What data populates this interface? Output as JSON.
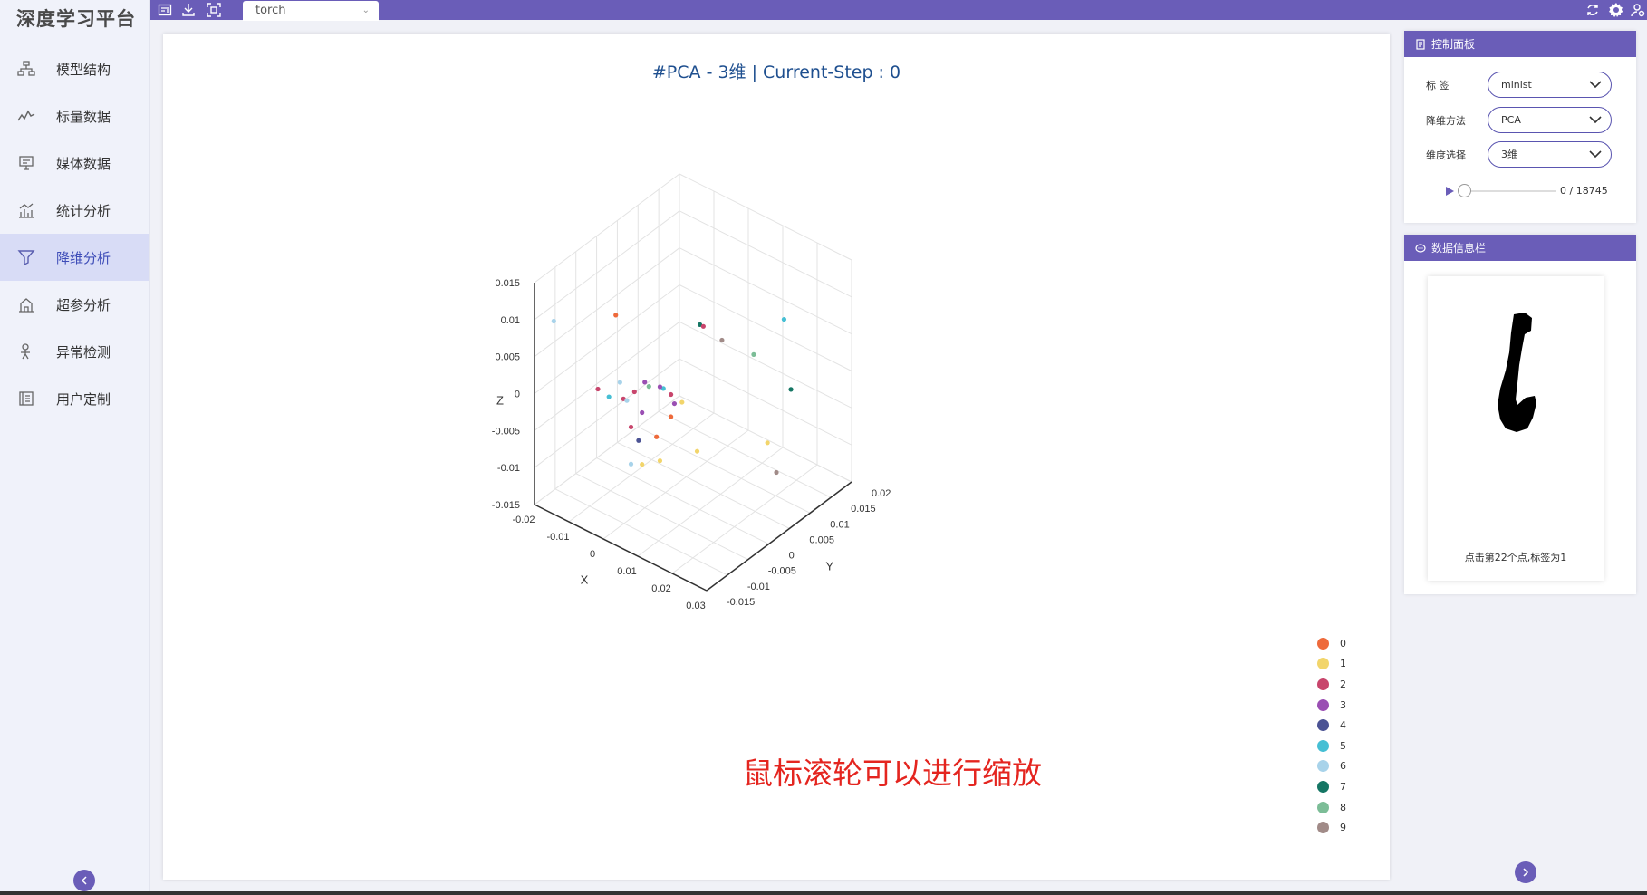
{
  "app": {
    "title": "深度学习平台"
  },
  "sidebar": {
    "items": [
      {
        "label": "模型结构",
        "icon": "model-structure-icon"
      },
      {
        "label": "标量数据",
        "icon": "scalar-line-icon"
      },
      {
        "label": "媒体数据",
        "icon": "media-monitor-icon"
      },
      {
        "label": "统计分析",
        "icon": "statistics-icon"
      },
      {
        "label": "降维分析",
        "icon": "funnel-icon",
        "active": true
      },
      {
        "label": "超参分析",
        "icon": "hyperparam-icon"
      },
      {
        "label": "异常检测",
        "icon": "anomaly-icon"
      },
      {
        "label": "用户定制",
        "icon": "custom-icon"
      }
    ]
  },
  "topbar": {
    "tab_label": "torch"
  },
  "chart": {
    "title": "#PCA - 3维 | Current-Step : 0",
    "zoom_hint": "鼠标滚轮可以进行缩放"
  },
  "chart_data": {
    "type": "scatter",
    "dimensions": 3,
    "xlabel": "X",
    "ylabel": "Y",
    "zlabel": "Z",
    "x_ticks": [
      "-0.02",
      "-0.01",
      "0",
      "0.01",
      "0.02",
      "0.03"
    ],
    "y_ticks": [
      "-0.015",
      "-0.01",
      "-0.005",
      "0",
      "0.005",
      "0.01",
      "0.015",
      "0.02"
    ],
    "z_ticks": [
      "-0.015",
      "-0.01",
      "-0.005",
      "0",
      "0.005",
      "0.01",
      "0.015"
    ],
    "legend": [
      {
        "name": "0",
        "color": "#ee6a3b"
      },
      {
        "name": "1",
        "color": "#f2d56b"
      },
      {
        "name": "2",
        "color": "#c8456c"
      },
      {
        "name": "3",
        "color": "#9a4fb3"
      },
      {
        "name": "4",
        "color": "#4b5394"
      },
      {
        "name": "5",
        "color": "#46bfd4"
      },
      {
        "name": "6",
        "color": "#a8d3ea"
      },
      {
        "name": "7",
        "color": "#157664"
      },
      {
        "name": "8",
        "color": "#7cbd97"
      },
      {
        "name": "9",
        "color": "#a18b88"
      }
    ],
    "points_screen_note": "projected scatter points",
    "points": [
      {
        "label": "0",
        "x": 0.0,
        "y": -0.012,
        "z": 0.014
      },
      {
        "label": "6",
        "x": -0.018,
        "y": -0.012,
        "z": 0.009
      },
      {
        "label": "7",
        "x": 0.01,
        "y": 0.0,
        "z": 0.01
      },
      {
        "label": "2",
        "x": 0.011,
        "y": 0.0,
        "z": 0.01
      },
      {
        "label": "9",
        "x": 0.014,
        "y": 0.002,
        "z": 0.008
      },
      {
        "label": "5",
        "x": 0.02,
        "y": 0.012,
        "z": 0.008
      },
      {
        "label": "8",
        "x": 0.016,
        "y": 0.008,
        "z": 0.004
      },
      {
        "label": "7",
        "x": 0.022,
        "y": 0.012,
        "z": -0.001
      },
      {
        "label": "3",
        "x": 0.0,
        "y": -0.005,
        "z": 0.002
      },
      {
        "label": "6",
        "x": -0.006,
        "y": -0.006,
        "z": 0.001
      },
      {
        "label": "2",
        "x": -0.01,
        "y": -0.008,
        "z": 0.0
      },
      {
        "label": "5",
        "x": -0.008,
        "y": -0.007,
        "z": -0.001
      },
      {
        "label": "2",
        "x": -0.005,
        "y": -0.006,
        "z": -0.001
      },
      {
        "label": "6",
        "x": -0.004,
        "y": -0.006,
        "z": -0.001
      },
      {
        "label": "2",
        "x": -0.003,
        "y": -0.005,
        "z": 0.0
      },
      {
        "label": "8",
        "x": 0.0,
        "y": -0.004,
        "z": 0.001
      },
      {
        "label": "5",
        "x": 0.003,
        "y": -0.003,
        "z": 0.001
      },
      {
        "label": "3",
        "x": 0.002,
        "y": -0.003,
        "z": 0.001
      },
      {
        "label": "2",
        "x": 0.004,
        "y": -0.002,
        "z": 0.0
      },
      {
        "label": "3",
        "x": 0.005,
        "y": -0.002,
        "z": -0.001
      },
      {
        "label": "1",
        "x": 0.006,
        "y": -0.001,
        "z": -0.001
      },
      {
        "label": "3",
        "x": -0.002,
        "y": -0.004,
        "z": -0.003
      },
      {
        "label": "0",
        "x": 0.004,
        "y": -0.002,
        "z": -0.003
      },
      {
        "label": "2",
        "x": -0.004,
        "y": -0.005,
        "z": -0.005
      },
      {
        "label": "0",
        "x": 0.001,
        "y": -0.003,
        "z": -0.006
      },
      {
        "label": "4",
        "x": -0.003,
        "y": -0.004,
        "z": -0.007
      },
      {
        "label": "1",
        "x": 0.008,
        "y": 0.001,
        "z": -0.008
      },
      {
        "label": "1",
        "x": 0.02,
        "y": 0.008,
        "z": -0.007
      },
      {
        "label": "1",
        "x": 0.002,
        "y": -0.003,
        "z": -0.009
      },
      {
        "label": "1",
        "x": -0.002,
        "y": -0.004,
        "z": -0.01
      },
      {
        "label": "6",
        "x": -0.004,
        "y": -0.005,
        "z": -0.01
      },
      {
        "label": "9",
        "x": 0.025,
        "y": 0.006,
        "z": -0.009
      }
    ]
  },
  "control_panel": {
    "title": "控制面板",
    "label_field": {
      "label": "标  签",
      "value": "minist"
    },
    "method_field": {
      "label": "降维方法",
      "value": "PCA"
    },
    "dim_field": {
      "label": "维度选择",
      "value": "3维"
    },
    "step_display": "0 / 18745",
    "step_value": 0,
    "step_max": 18745
  },
  "info_panel": {
    "title": "数据信息栏",
    "info_text": "点击第22个点,标签为1"
  }
}
